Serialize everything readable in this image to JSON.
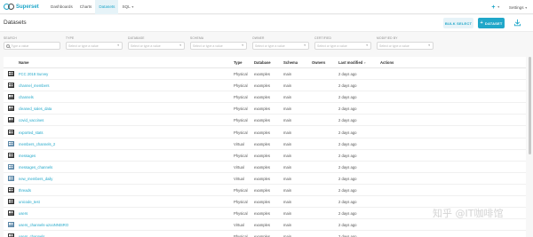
{
  "app": {
    "name": "Superset"
  },
  "nav": {
    "tabs": [
      {
        "label": "Dashboards",
        "active": false
      },
      {
        "label": "Charts",
        "active": false
      },
      {
        "label": "Datasets",
        "active": true
      },
      {
        "label": "SQL",
        "active": false
      }
    ],
    "settings_label": "Settings"
  },
  "page": {
    "title": "Datasets",
    "bulk_select_label": "BULK SELECT",
    "add_dataset_label": "DATASET"
  },
  "filters": {
    "search": {
      "label": "Search",
      "placeholder": "Type a value"
    },
    "type": {
      "label": "TYPE",
      "placeholder": "Select or type a value"
    },
    "database": {
      "label": "DATABASE",
      "placeholder": "Select or type a value"
    },
    "schema": {
      "label": "SCHEMA",
      "placeholder": "Select or type a value"
    },
    "owner": {
      "label": "OWNER",
      "placeholder": "Select or type a value"
    },
    "certified": {
      "label": "CERTIFIED",
      "placeholder": "Select or type a value"
    },
    "modified_by": {
      "label": "MODIFIED BY",
      "placeholder": "Select or type a value"
    }
  },
  "table": {
    "columns": {
      "name": "Name",
      "type": "Type",
      "database": "Database",
      "schema": "Schema",
      "owners": "Owners",
      "last_modified": "Last modified",
      "actions": "Actions"
    },
    "rows": [
      {
        "name": "FCC 2018 Survey",
        "type": "Physical",
        "database": "examples",
        "schema": "main",
        "modified": "2 days ago"
      },
      {
        "name": "channel_members",
        "type": "Physical",
        "database": "examples",
        "schema": "main",
        "modified": "2 days ago"
      },
      {
        "name": "channels",
        "type": "Physical",
        "database": "examples",
        "schema": "main",
        "modified": "2 days ago"
      },
      {
        "name": "cleaned_sales_data",
        "type": "Physical",
        "database": "examples",
        "schema": "main",
        "modified": "2 days ago"
      },
      {
        "name": "covid_vaccines",
        "type": "Physical",
        "database": "examples",
        "schema": "main",
        "modified": "2 days ago"
      },
      {
        "name": "exported_stats",
        "type": "Physical",
        "database": "examples",
        "schema": "main",
        "modified": "2 days ago"
      },
      {
        "name": "members_channels_2",
        "type": "Virtual",
        "database": "examples",
        "schema": "main",
        "modified": "2 days ago"
      },
      {
        "name": "messages",
        "type": "Physical",
        "database": "examples",
        "schema": "main",
        "modified": "2 days ago"
      },
      {
        "name": "messages_channels",
        "type": "Virtual",
        "database": "examples",
        "schema": "main",
        "modified": "2 days ago"
      },
      {
        "name": "new_members_daily",
        "type": "Virtual",
        "database": "examples",
        "schema": "main",
        "modified": "2 days ago"
      },
      {
        "name": "threads",
        "type": "Physical",
        "database": "examples",
        "schema": "main",
        "modified": "2 days ago"
      },
      {
        "name": "unicode_test",
        "type": "Physical",
        "database": "examples",
        "schema": "main",
        "modified": "2 days ago"
      },
      {
        "name": "users",
        "type": "Physical",
        "database": "examples",
        "schema": "main",
        "modified": "2 days ago"
      },
      {
        "name": "users_channels-uzooNNtSRO",
        "type": "Virtual",
        "database": "examples",
        "schema": "main",
        "modified": "2 days ago"
      },
      {
        "name": "users_channels",
        "type": "Physical",
        "database": "examples",
        "schema": "main",
        "modified": "2 days ago"
      }
    ]
  },
  "watermark": "知乎 @IT咖啡馆",
  "colors": {
    "accent": "#20a7c9",
    "accent_light": "#e6f3f8"
  }
}
